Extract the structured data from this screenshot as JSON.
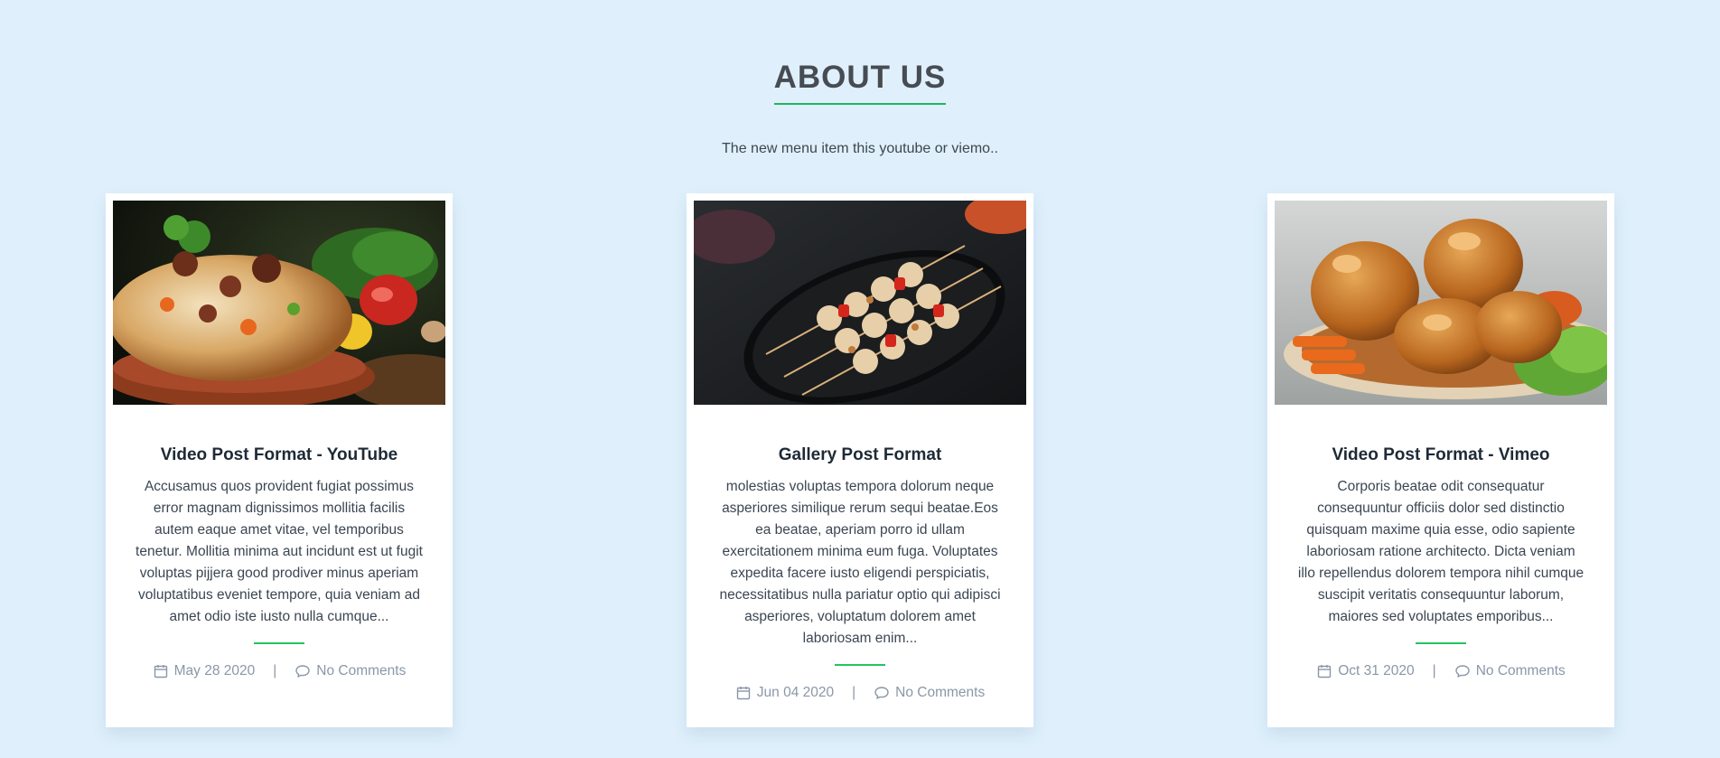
{
  "section": {
    "title": "ABOUT US",
    "subtitle": "The new menu item this youtube or viemo..",
    "accent_color": "#1fb55c",
    "background_color": "#dff0fc"
  },
  "posts": [
    {
      "image_subject": "biryani rice dish in clay bowl",
      "title": "Video Post Format - YouTube",
      "excerpt": "Accusamus quos provident fugiat possimus error magnam dignissimos mollitia facilis autem eaque amet vitae, vel temporibus tenetur. Mollitia minima aut incidunt est ut fugit voluptas pijjera good prodiver minus aperiam voluptatibus eveniet tempore, quia veniam ad amet odio iste iusto nulla cumque...",
      "date": "May 28 2020",
      "comments": "No Comments",
      "date_icon": "calendar-icon",
      "comments_icon": "comment-icon"
    },
    {
      "image_subject": "chicken kebab skewers on black plate",
      "title": "Gallery Post Format",
      "excerpt": "molestias voluptas tempora dolorum neque asperiores similique rerum sequi beatae.Eos ea beatae, aperiam porro id ullam exercitationem minima eum fuga. Voluptates expedita facere iusto eligendi perspiciatis, necessitatibus nulla pariatur optio qui adipisci asperiores, voluptatum dolorem amet laboriosam enim...",
      "date": "Jun 04 2020",
      "comments": "No Comments",
      "date_icon": "calendar-icon",
      "comments_icon": "comment-icon"
    },
    {
      "image_subject": "fried chicken with carrots and lettuce",
      "title": "Video Post Format - Vimeo",
      "excerpt": "Corporis beatae odit consequatur consequuntur officiis dolor sed distinctio quisquam maxime quia esse, odio sapiente laboriosam ratione architecto. Dicta veniam illo repellendus dolorem tempora nihil cumque suscipit veritatis consequuntur laborum, maiores sed voluptates emporibus...",
      "date": "Oct 31 2020",
      "comments": "No Comments",
      "date_icon": "calendar-icon",
      "comments_icon": "comment-icon"
    }
  ],
  "meta_separator": "|"
}
